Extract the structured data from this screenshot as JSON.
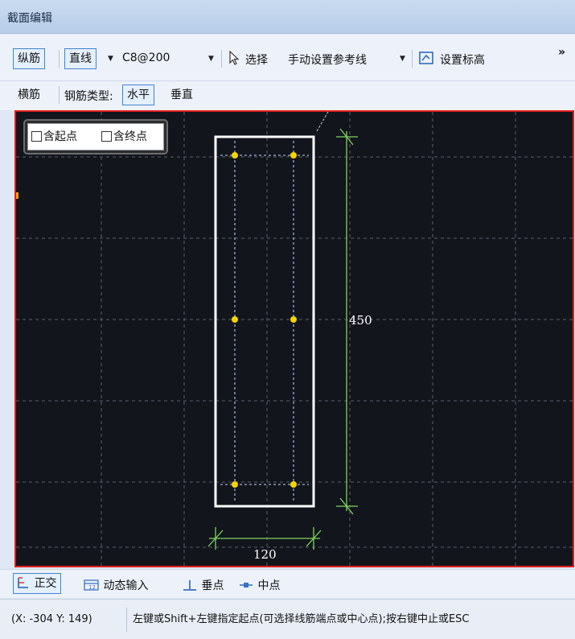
{
  "window": {
    "title": "截面编辑"
  },
  "toolbar1": {
    "longitudinal": "纵筋",
    "line": "直线",
    "rebar_spec": "C8@200",
    "select": "选择",
    "manual_ref": "手动设置参考线",
    "set_elevation": "设置标高",
    "overflow": "»"
  },
  "toolbar2": {
    "transverse": "横筋",
    "rebar_type_label": "钢筋类型:",
    "horizontal": "水平",
    "vertical": "垂直"
  },
  "point_options": {
    "include_start": "含起点",
    "include_end": "含终点"
  },
  "dimensions": {
    "height": "450",
    "width": "120"
  },
  "bottom_toolbar": {
    "ortho": "正交",
    "dynamic_input": "动态输入",
    "perpendicular": "垂点",
    "midpoint": "中点"
  },
  "status": {
    "coords": "(X: -304 Y: 149)",
    "hint": "左键或Shift+左键指定起点(可选择线筋端点或中心点);按右键中止或ESC"
  },
  "colors": {
    "canvas_bg": "#12151c",
    "canvas_border": "#e01d1d",
    "rebar_point": "#f5d400",
    "dimension": "#7fd45f",
    "section_outline": "#ffffff",
    "active_border": "#3f83d2"
  }
}
